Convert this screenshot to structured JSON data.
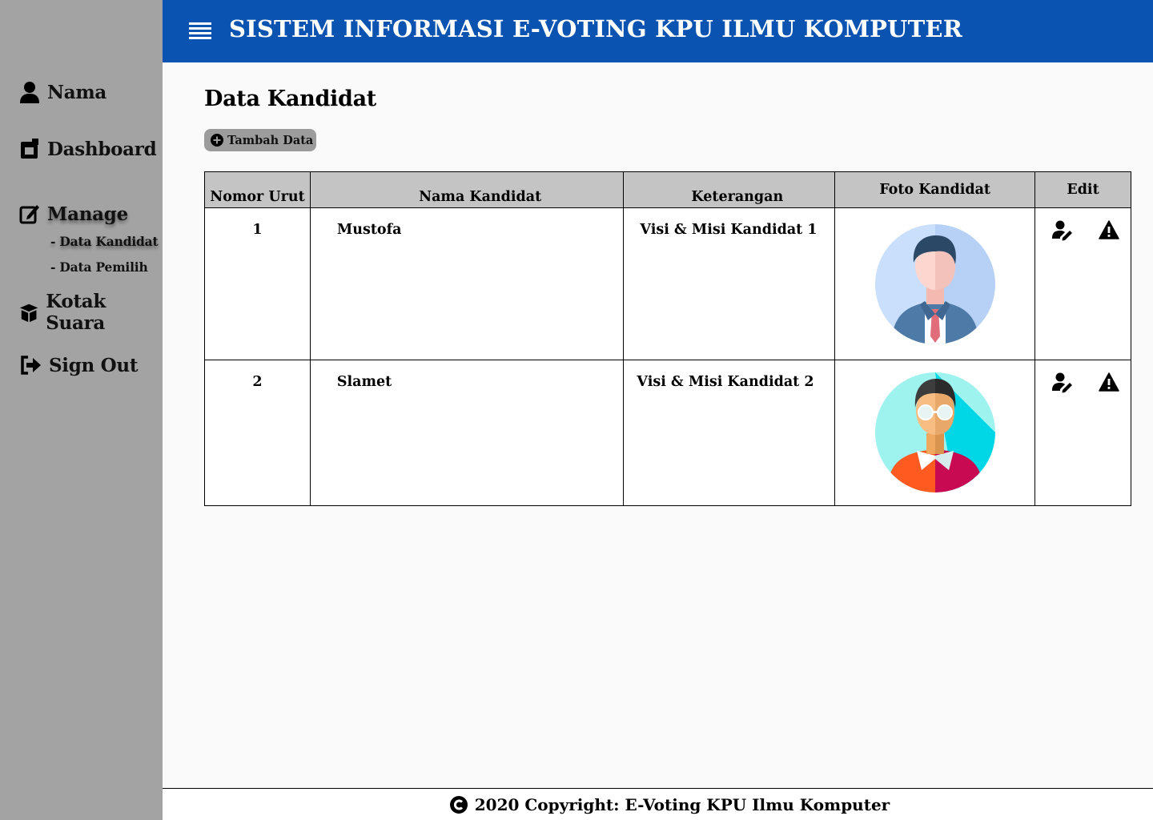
{
  "header": {
    "title": "SISTEM INFORMASI E-VOTING KPU ILMU KOMPUTER"
  },
  "sidebar": {
    "user_label": "Nama",
    "dashboard": "Dashboard",
    "manage": "Manage",
    "manage_items": [
      "- Data Kandidat",
      "- Data Pemilih"
    ],
    "kotak_suara": "Kotak Suara",
    "sign_out": "Sign Out"
  },
  "page": {
    "title": "Data Kandidat",
    "add_button": "Tambah Data"
  },
  "table": {
    "columns": [
      "Nomor Urut",
      "Nama Kandidat",
      "Keterangan",
      "Foto Kandidat",
      "Edit"
    ],
    "rows": [
      {
        "no": "1",
        "nama": "Mustofa",
        "keterangan": "Visi & Misi Kandidat 1",
        "foto": "avatar-businessman"
      },
      {
        "no": "2",
        "nama": "Slamet",
        "keterangan": "Visi & Misi Kandidat 2",
        "foto": "avatar-glasses-man"
      }
    ]
  },
  "footer": {
    "text": "2020 Copyright: E-Voting KPU Ilmu Komputer"
  },
  "colors": {
    "topbar": "#0b53b0",
    "sidebar": "#a3a3a3",
    "header_cell": "#c4c4c4"
  }
}
